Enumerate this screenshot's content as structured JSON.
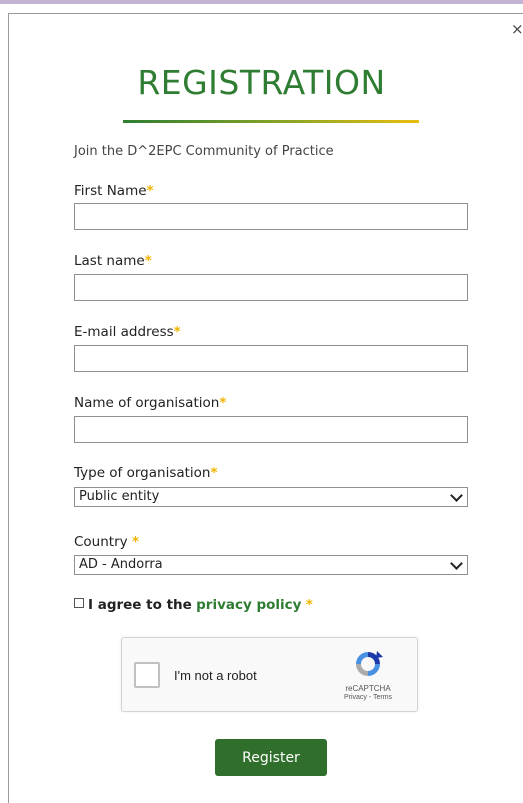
{
  "modal": {
    "close_glyph": "×",
    "title": "REGISTRATION",
    "subtitle": "Join the D^2EPC Community of Practice"
  },
  "form": {
    "required_mark": "*",
    "first_name": {
      "label": "First Name",
      "value": ""
    },
    "last_name": {
      "label": "Last name",
      "value": ""
    },
    "email": {
      "label": "E-mail address",
      "value": ""
    },
    "organisation": {
      "label": "Name of organisation",
      "value": ""
    },
    "org_type": {
      "label": "Type of organisation",
      "selected": "Public entity"
    },
    "country": {
      "label": "Country",
      "selected": "AD - Andorra"
    },
    "agree": {
      "prefix": "I agree to the",
      "link": "privacy policy",
      "checked": false
    }
  },
  "captcha": {
    "label": "I'm not a robot",
    "brand": "reCAPTCHA",
    "terms": "Privacy - Terms",
    "checked": false
  },
  "submit": {
    "label": "Register"
  },
  "colors": {
    "accent_green": "#2e7d32",
    "required_star": "#f0b400",
    "button_green": "#2f6f2b",
    "gradient_end": "#e9bd0e"
  },
  "icons": {
    "close": "close-icon",
    "dropdown": "chevron-down-icon",
    "captcha_logo": "recaptcha-logo-icon"
  }
}
